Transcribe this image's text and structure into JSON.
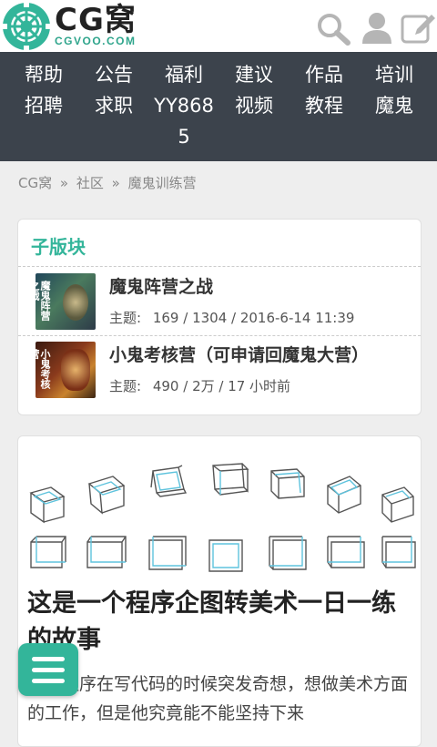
{
  "header": {
    "logo_main": "CG窝",
    "logo_sub": "CGVOO.COM",
    "icons": [
      "search-icon",
      "user-icon",
      "edit-icon"
    ],
    "accent": "#33b59a"
  },
  "nav": {
    "items": [
      {
        "top": "帮助",
        "bottom": "招聘"
      },
      {
        "top": "公告",
        "bottom": "求职"
      },
      {
        "top": "福利",
        "bottom": "YY868",
        "extra": "5"
      },
      {
        "top": "建议",
        "bottom": "视频"
      },
      {
        "top": "作品",
        "bottom": "教程"
      },
      {
        "top": "培训",
        "bottom": "魔鬼"
      }
    ]
  },
  "breadcrumb": {
    "items": [
      "CG窝",
      "社区",
      "魔鬼训练营"
    ],
    "separator": "»"
  },
  "subforums": {
    "title": "子版块",
    "meta_label": "主题:",
    "items": [
      {
        "name": "魔鬼阵营之战",
        "thumb_text": "魔鬼阵营之战",
        "stats": "169 / 1304 / 2016-6-14 11:39"
      },
      {
        "name": "小鬼考核营（可申请回魔鬼大营）",
        "thumb_text": "小鬼考核营",
        "stats": "490 / 2万 / 17 小时前"
      }
    ]
  },
  "article": {
    "title": "这是一个程序企图转美术一日一练的故事",
    "body": "一个程序在写代码的时候突发奇想，想做美术方面的工作，但是他究竟能不能坚持下来"
  },
  "fab": {
    "icon": "menu-icon"
  }
}
